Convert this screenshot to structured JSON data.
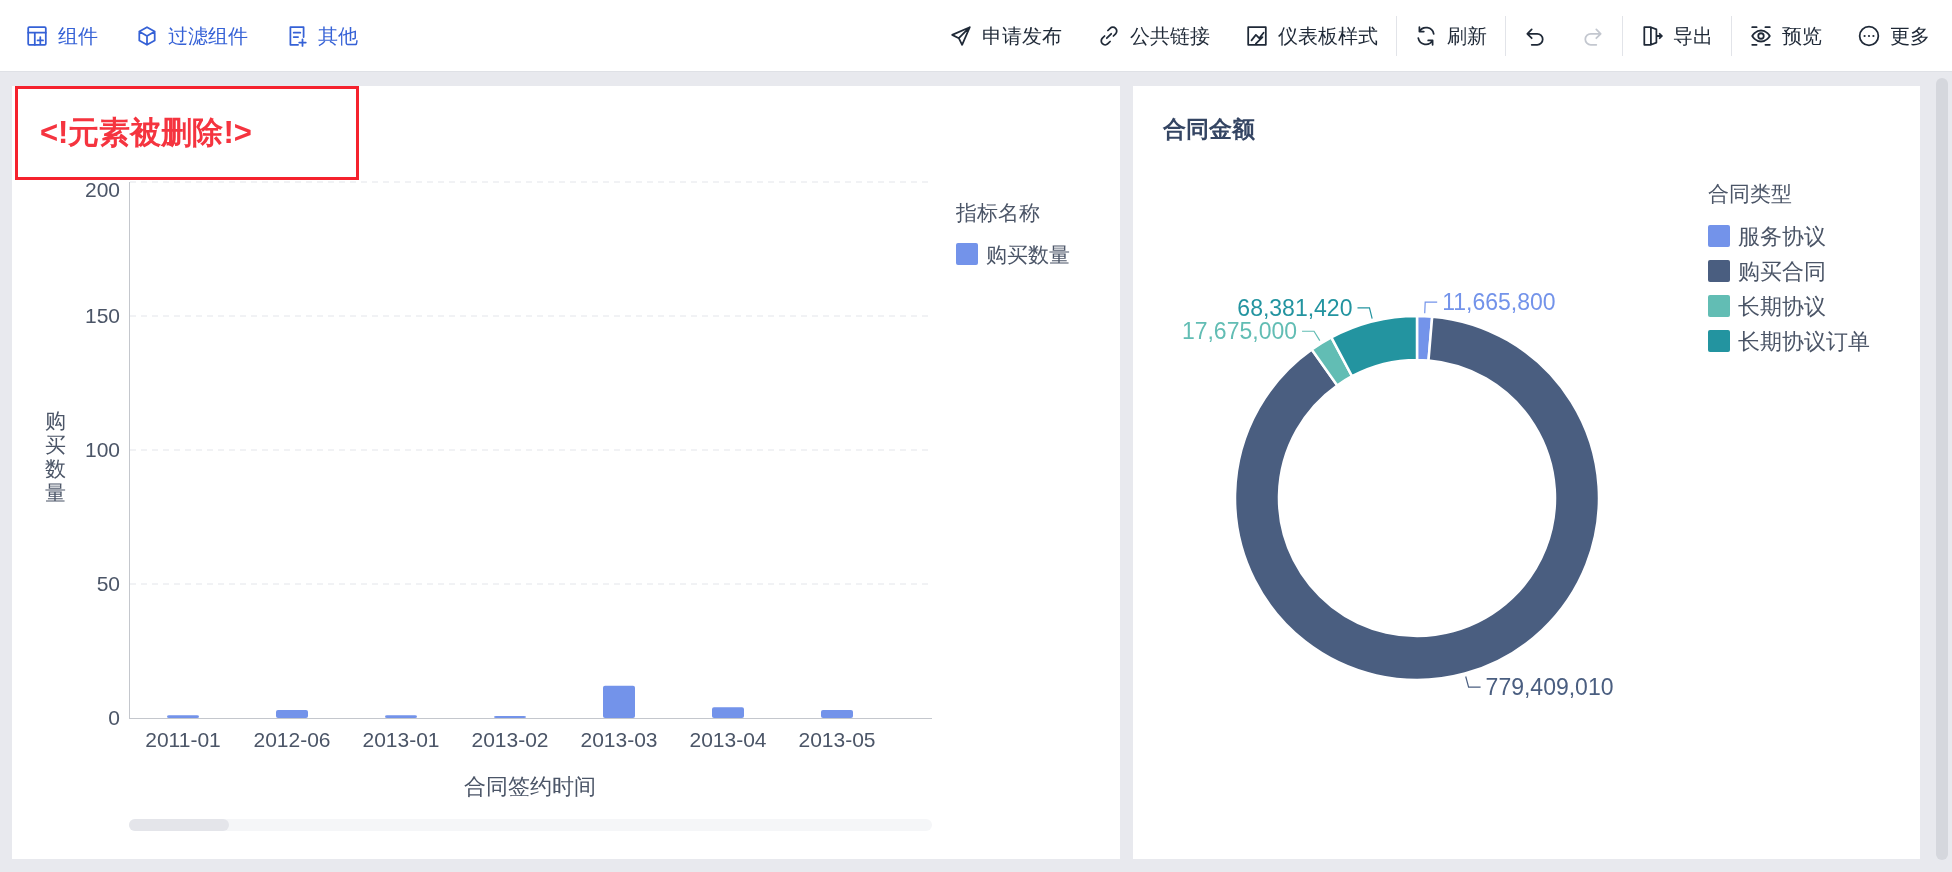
{
  "toolbar": {
    "left": [
      {
        "label": "组件"
      },
      {
        "label": "过滤组件"
      },
      {
        "label": "其他"
      }
    ],
    "right_groups": [
      [
        {
          "kind": "text",
          "label": "申请发布"
        },
        {
          "kind": "text",
          "label": "公共链接"
        },
        {
          "kind": "text",
          "label": "仪表板样式"
        }
      ],
      [
        {
          "kind": "text",
          "label": "刷新"
        }
      ],
      [
        {
          "kind": "icon",
          "disabled": false
        },
        {
          "kind": "icon",
          "disabled": true
        }
      ],
      [
        {
          "kind": "text",
          "label": "导出"
        }
      ],
      [
        {
          "kind": "text",
          "label": "预览"
        },
        {
          "kind": "text",
          "label": "更多"
        }
      ]
    ]
  },
  "bar_card": {
    "title": "<!元素被删除!>",
    "chart_data": {
      "type": "bar",
      "xlabel": "合同签约时间",
      "ylabel": "购买数量",
      "legend": {
        "title": "指标名称"
      },
      "categories": [
        "2011-01",
        "2012-06",
        "2013-01",
        "2013-02",
        "2013-03",
        "2013-04",
        "2013-05"
      ],
      "series": [
        {
          "name": "购买数量",
          "color": "#7393ea",
          "values": [
            1,
            3,
            1,
            0.5,
            12,
            4,
            3
          ]
        }
      ],
      "ylim": [
        0,
        200
      ],
      "grid": true,
      "yticks": [
        0,
        50,
        100,
        150,
        200
      ]
    }
  },
  "donut_card": {
    "title": "合同金额",
    "chart_data": {
      "type": "donut",
      "legend": {
        "title": "合同类型"
      },
      "categories": [
        "服务协议",
        "购买合同",
        "长期协议",
        "长期协议订单"
      ],
      "values": [
        11665800,
        779409010,
        17675000,
        68381420
      ],
      "colors": [
        "#7393ea",
        "#4a5e80",
        "#62bdb4",
        "#2394a0"
      ],
      "value_labels": [
        "11,665,800",
        "779,409,010",
        "17,675,000",
        "68,381,420"
      ]
    }
  }
}
